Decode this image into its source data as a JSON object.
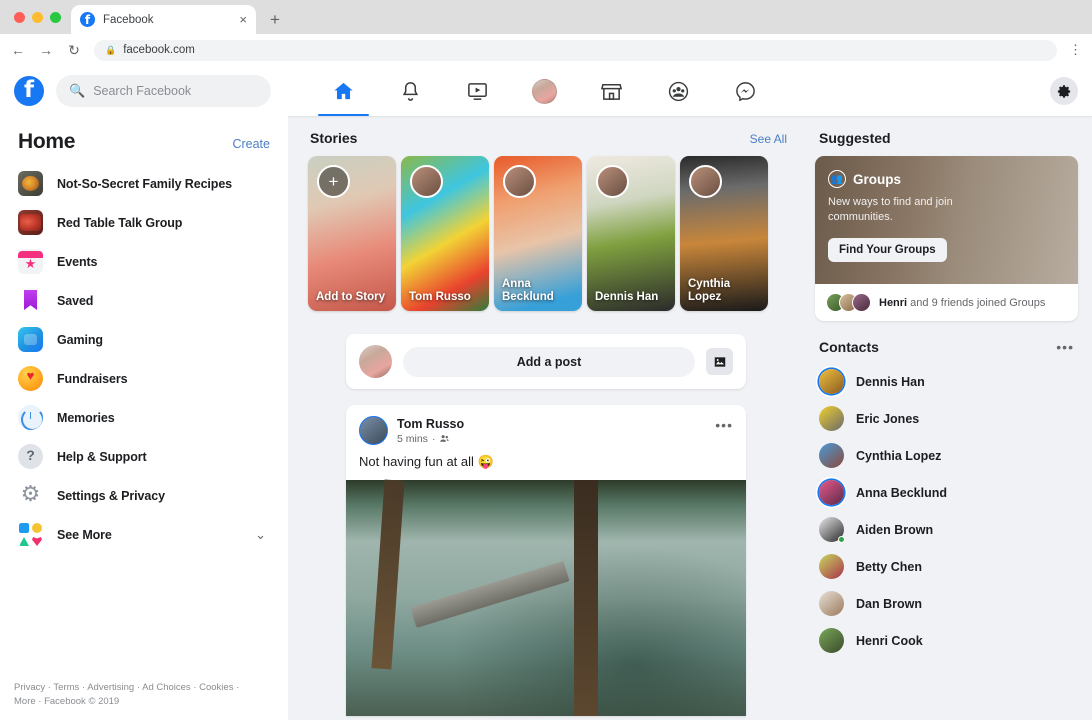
{
  "browser": {
    "tab": {
      "title": "Facebook",
      "favicon": "facebook-icon",
      "close": "×"
    },
    "new_tab": "+",
    "back": "←",
    "forward": "→",
    "reload": "↻",
    "lock": "🔒",
    "url": "facebook.com",
    "menu": "⋮"
  },
  "header": {
    "logo": "facebook-logo",
    "search_placeholder": "Search Facebook",
    "search_value": "",
    "nav": [
      {
        "name": "home",
        "icon": "home-icon",
        "active": true
      },
      {
        "name": "notifications",
        "icon": "bell-icon",
        "active": false
      },
      {
        "name": "watch",
        "icon": "video-icon",
        "active": false
      },
      {
        "name": "profile",
        "icon": "avatar-icon",
        "active": false
      },
      {
        "name": "marketplace",
        "icon": "store-icon",
        "active": false
      },
      {
        "name": "groups",
        "icon": "groups-icon",
        "active": false
      },
      {
        "name": "messenger",
        "icon": "messenger-icon",
        "active": false
      }
    ],
    "settings": "gear-icon"
  },
  "sidebar": {
    "title": "Home",
    "create": "Create",
    "items": [
      {
        "label": "Not-So-Secret Family Recipes",
        "icon": "recipes-thumbnail"
      },
      {
        "label": "Red Table Talk Group",
        "icon": "red-table-thumbnail"
      },
      {
        "label": "Events",
        "icon": "events-icon"
      },
      {
        "label": "Saved",
        "icon": "bookmark-icon"
      },
      {
        "label": "Gaming",
        "icon": "gaming-icon"
      },
      {
        "label": "Fundraisers",
        "icon": "heart-icon"
      },
      {
        "label": "Memories",
        "icon": "clock-icon"
      },
      {
        "label": "Help & Support",
        "icon": "question-icon"
      },
      {
        "label": "Settings & Privacy",
        "icon": "gear-icon"
      },
      {
        "label": "See More",
        "icon": "shapes-icon",
        "chevron": "⌄"
      }
    ],
    "footer_line1": "Privacy · Terms · Advertising · Ad Choices · Cookies ·",
    "footer_line2": "More · Facebook © 2019"
  },
  "stories": {
    "title": "Stories",
    "see_all": "See All",
    "items": [
      {
        "name": "Add to Story",
        "add": true,
        "plus": "+"
      },
      {
        "name": "Tom Russo",
        "add": false
      },
      {
        "name": "Anna Becklund",
        "add": false
      },
      {
        "name": "Dennis Han",
        "add": false
      },
      {
        "name": "Cynthia Lopez",
        "add": false
      }
    ]
  },
  "composer": {
    "placeholder": "Add a post",
    "photo_icon": "photo-icon"
  },
  "post": {
    "author": "Tom Russo",
    "time": "5 mins",
    "audience_icon": "friends-icon",
    "separator": "·",
    "menu": "•••",
    "text": "Not having fun at all 😜",
    "image_alt": "people-jumping-into-lake"
  },
  "suggested": {
    "title": "Suggested",
    "card_badge": "Groups",
    "card_badge_icon": "groups-icon",
    "card_desc": "New ways to find and join communities.",
    "card_button": "Find Your Groups",
    "footer_bold": "Henri",
    "footer_rest": " and 9 friends joined Groups"
  },
  "contacts": {
    "title": "Contacts",
    "menu": "•••",
    "items": [
      {
        "name": "Dennis Han",
        "ring": true,
        "online": false,
        "av": "a-dennis"
      },
      {
        "name": "Eric Jones",
        "ring": false,
        "online": false,
        "av": "a-eric"
      },
      {
        "name": "Cynthia Lopez",
        "ring": false,
        "online": false,
        "av": "a-cynthia"
      },
      {
        "name": "Anna Becklund",
        "ring": true,
        "online": false,
        "av": "a-anna"
      },
      {
        "name": "Aiden Brown",
        "ring": false,
        "online": true,
        "av": "a-aiden"
      },
      {
        "name": "Betty Chen",
        "ring": false,
        "online": false,
        "av": "a-betty"
      },
      {
        "name": "Dan Brown",
        "ring": false,
        "online": false,
        "av": "a-dan"
      },
      {
        "name": "Henri Cook",
        "ring": false,
        "online": false,
        "av": "a-henri"
      }
    ]
  },
  "colors": {
    "brand_blue": "#1877f2",
    "link_blue": "#4a7ec4",
    "page_bg": "#f0f2f5",
    "card_bg": "#ffffff",
    "text_primary": "#1c1e21",
    "text_secondary": "#65676b",
    "online_green": "#31a24c"
  }
}
